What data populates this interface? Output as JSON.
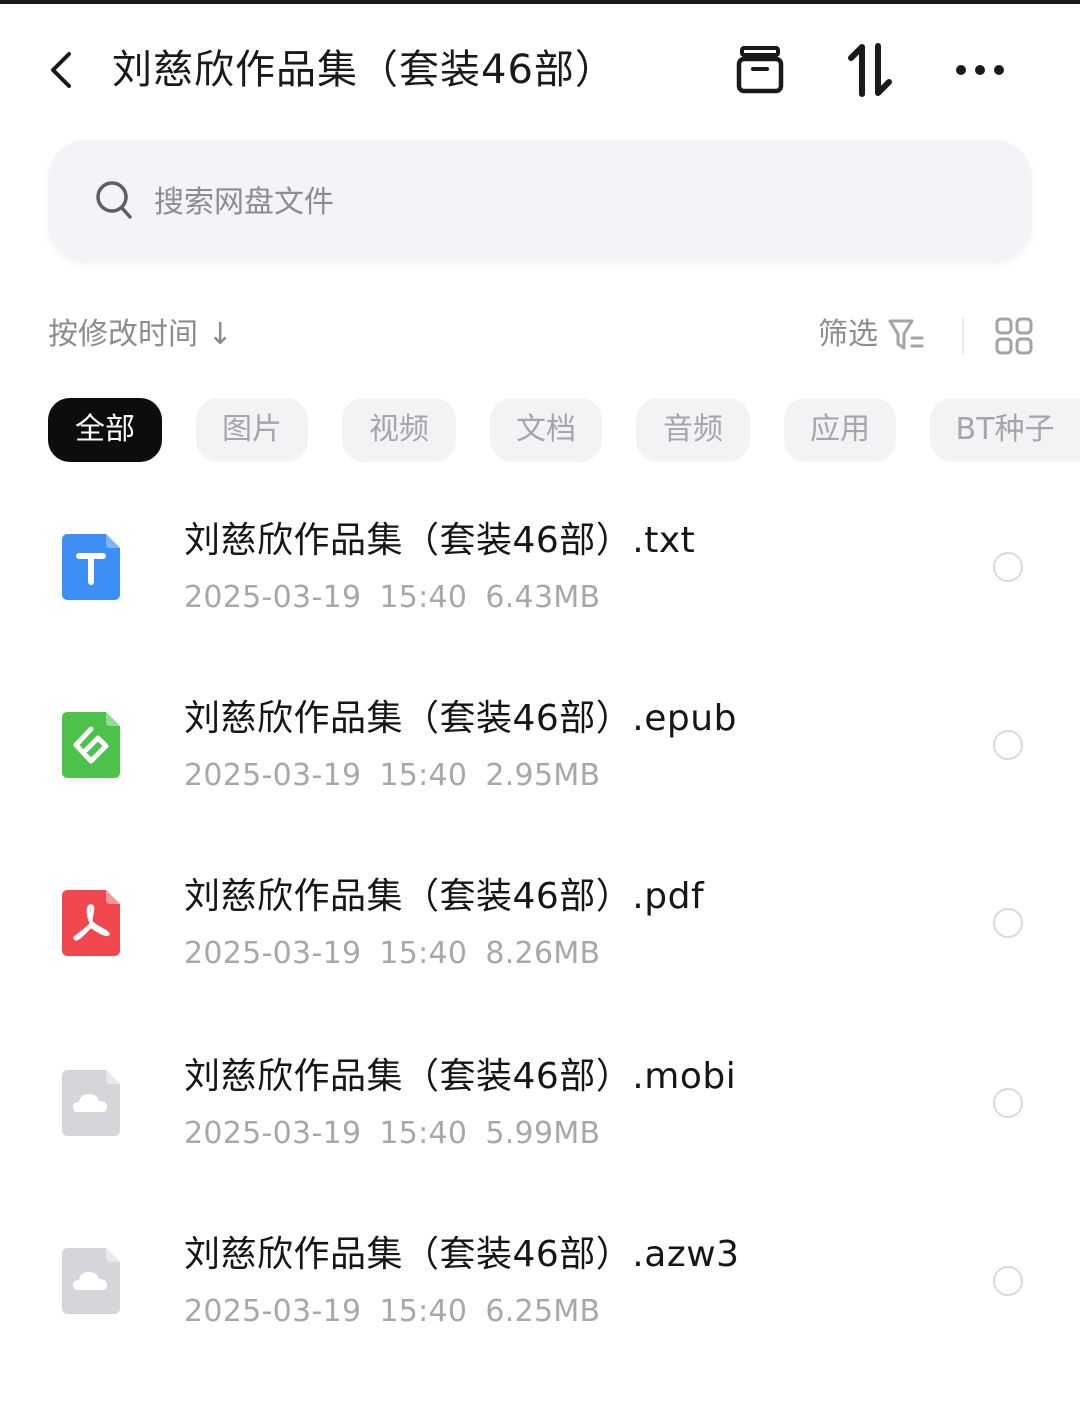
{
  "header": {
    "title": "刘慈欣作品集（套装46部）"
  },
  "search": {
    "placeholder": "搜索网盘文件"
  },
  "toolbar": {
    "sort_label": "按修改时间",
    "sort_arrow": "↓",
    "filter_label": "筛选"
  },
  "tabs": [
    {
      "label": "全部"
    },
    {
      "label": "图片"
    },
    {
      "label": "视频"
    },
    {
      "label": "文档"
    },
    {
      "label": "音频"
    },
    {
      "label": "应用"
    },
    {
      "label": "BT种子"
    }
  ],
  "files": [
    {
      "name": "刘慈欣作品集（套装46部）.txt",
      "date": "2025-03-19",
      "time": "15:40",
      "size": "6.43MB",
      "icon": "txt-file-icon",
      "color": "#3d8ff5"
    },
    {
      "name": "刘慈欣作品集（套装46部）.epub",
      "date": "2025-03-19",
      "time": "15:40",
      "size": "2.95MB",
      "icon": "epub-file-icon",
      "color": "#4cc24a"
    },
    {
      "name": "刘慈欣作品集（套装46部）.pdf",
      "date": "2025-03-19",
      "time": "15:40",
      "size": "8.26MB",
      "icon": "pdf-file-icon",
      "color": "#f1484f"
    },
    {
      "name": "刘慈欣作品集（套装46部）.mobi",
      "date": "2025-03-19",
      "time": "15:40",
      "size": "5.99MB",
      "icon": "unknown-file-icon",
      "color": "#d4d6da"
    },
    {
      "name": "刘慈欣作品集（套装46部）.azw3",
      "date": "2025-03-19",
      "time": "15:40",
      "size": "6.25MB",
      "icon": "unknown-file-icon",
      "color": "#d4d6da"
    }
  ]
}
